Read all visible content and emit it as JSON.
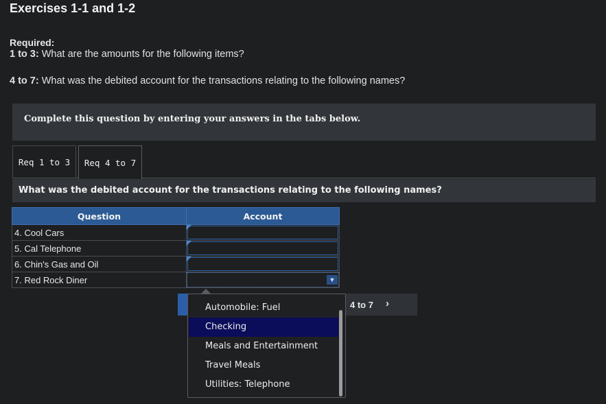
{
  "header": {
    "title": "Exercises 1-1 and 1-2",
    "required_label": "Required:",
    "q1_prefix": "1 to 3:",
    "q1_text": " What are the amounts for the following items?",
    "q2_prefix": "4 to 7:",
    "q2_text": " What was the debited account for the transactions relating to the following names?"
  },
  "instructions": "Complete this question by entering your answers in the tabs below.",
  "tabs": [
    {
      "label": "Req 1 to 3",
      "active": false
    },
    {
      "label": "Req 4 to 7",
      "active": true
    }
  ],
  "subquestion": "What was the debited account for the transactions relating to the following names?",
  "table": {
    "columns": [
      "Question",
      "Account"
    ],
    "rows": [
      {
        "question": "4. Cool Cars",
        "account": ""
      },
      {
        "question": "5. Cal Telephone",
        "account": ""
      },
      {
        "question": "6. Chin's Gas and Oil",
        "account": ""
      },
      {
        "question": "7. Red Rock Diner",
        "account": ""
      }
    ]
  },
  "nav": {
    "next_label": "4 to 7",
    "next_icon": "chevron-right-icon"
  },
  "dropdown": {
    "options": [
      "Automobile: Fuel",
      "Checking",
      "Meals and Entertainment",
      "Travel Meals",
      "Utilities: Telephone"
    ],
    "highlighted": "Checking",
    "highlight_color": "#0b0c5a"
  },
  "colors": {
    "table_header": "#2b5a94",
    "panel": "#323539",
    "background": "#1e1f21"
  }
}
